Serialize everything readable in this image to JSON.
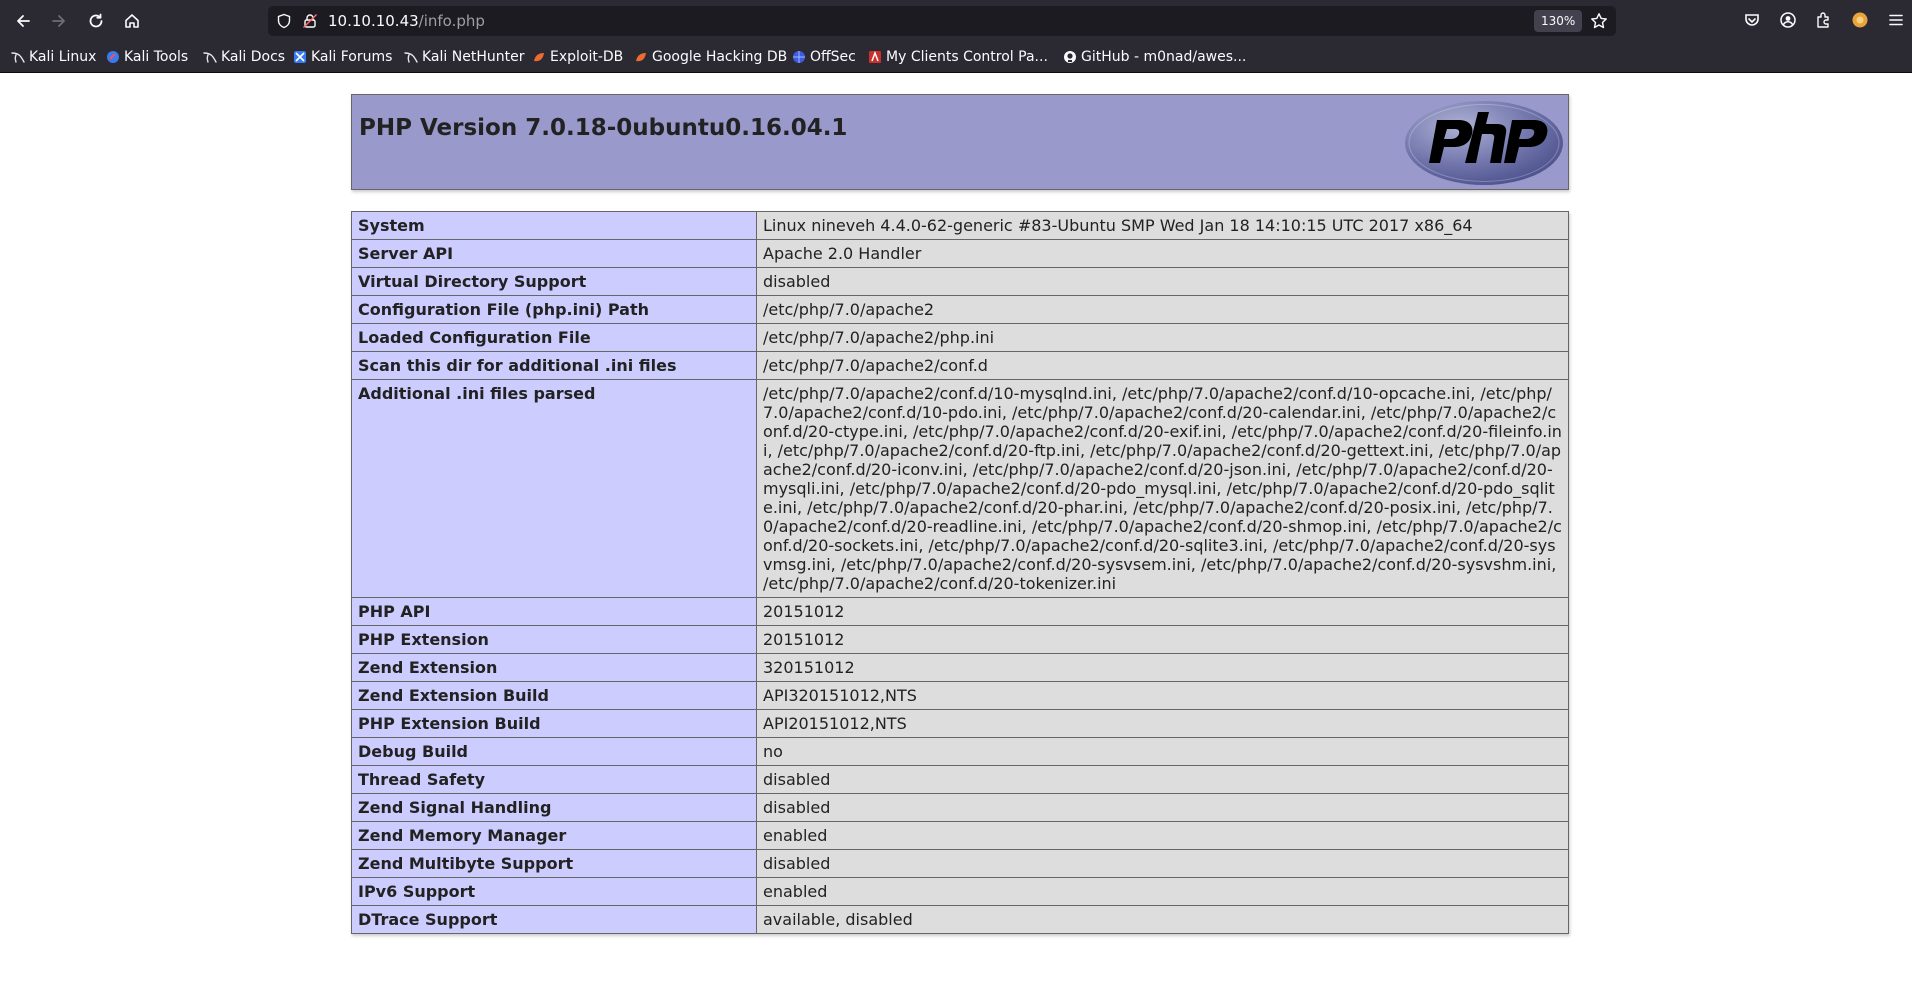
{
  "browser": {
    "url_host": "10.10.10.43",
    "url_path": "/info.php",
    "zoom": "130%",
    "bookmarks": [
      {
        "label": "Kali Linux",
        "icon": "kali-dragon-icon"
      },
      {
        "label": "Kali Tools",
        "icon": "kali-tools-icon"
      },
      {
        "label": "Kali Docs",
        "icon": "kali-dragon-icon"
      },
      {
        "label": "Kali Forums",
        "icon": "kali-forums-icon"
      },
      {
        "label": "Kali NetHunter",
        "icon": "kali-dragon-icon"
      },
      {
        "label": "Exploit-DB",
        "icon": "exploit-db-icon"
      },
      {
        "label": "Google Hacking DB",
        "icon": "exploit-db-icon"
      },
      {
        "label": "OffSec",
        "icon": "offsec-icon"
      },
      {
        "label": "My Clients Control Pa...",
        "icon": "clients-icon"
      },
      {
        "label": "GitHub - m0nad/awes...",
        "icon": "github-icon"
      }
    ]
  },
  "php": {
    "title": "PHP Version 7.0.18-0ubuntu0.16.04.1",
    "rows": [
      {
        "key": "System",
        "value": "Linux nineveh 4.4.0-62-generic #83-Ubuntu SMP Wed Jan 18 14:10:15 UTC 2017 x86_64"
      },
      {
        "key": "Server API",
        "value": "Apache 2.0 Handler"
      },
      {
        "key": "Virtual Directory Support",
        "value": "disabled"
      },
      {
        "key": "Configuration File (php.ini) Path",
        "value": "/etc/php/7.0/apache2"
      },
      {
        "key": "Loaded Configuration File",
        "value": "/etc/php/7.0/apache2/php.ini"
      },
      {
        "key": "Scan this dir for additional .ini files",
        "value": "/etc/php/7.0/apache2/conf.d"
      },
      {
        "key": "Additional .ini files parsed",
        "value": "/etc/php/7.0/apache2/conf.d/10-mysqlnd.ini, /etc/php/7.0/apache2/conf.d/10-opcache.ini, /etc/php/7.0/apache2/conf.d/10-pdo.ini, /etc/php/7.0/apache2/conf.d/20-calendar.ini, /etc/php/7.0/apache2/conf.d/20-ctype.ini, /etc/php/7.0/apache2/conf.d/20-exif.ini, /etc/php/7.0/apache2/conf.d/20-fileinfo.ini, /etc/php/7.0/apache2/conf.d/20-ftp.ini, /etc/php/7.0/apache2/conf.d/20-gettext.ini, /etc/php/7.0/apache2/conf.d/20-iconv.ini, /etc/php/7.0/apache2/conf.d/20-json.ini, /etc/php/7.0/apache2/conf.d/20-mysqli.ini, /etc/php/7.0/apache2/conf.d/20-pdo_mysql.ini, /etc/php/7.0/apache2/conf.d/20-pdo_sqlite.ini, /etc/php/7.0/apache2/conf.d/20-phar.ini, /etc/php/7.0/apache2/conf.d/20-posix.ini, /etc/php/7.0/apache2/conf.d/20-readline.ini, /etc/php/7.0/apache2/conf.d/20-shmop.ini, /etc/php/7.0/apache2/conf.d/20-sockets.ini, /etc/php/7.0/apache2/conf.d/20-sqlite3.ini, /etc/php/7.0/apache2/conf.d/20-sysvmsg.ini, /etc/php/7.0/apache2/conf.d/20-sysvsem.ini, /etc/php/7.0/apache2/conf.d/20-sysvshm.ini, /etc/php/7.0/apache2/conf.d/20-tokenizer.ini"
      },
      {
        "key": "PHP API",
        "value": "20151012"
      },
      {
        "key": "PHP Extension",
        "value": "20151012"
      },
      {
        "key": "Zend Extension",
        "value": "320151012"
      },
      {
        "key": "Zend Extension Build",
        "value": "API320151012,NTS"
      },
      {
        "key": "PHP Extension Build",
        "value": "API20151012,NTS"
      },
      {
        "key": "Debug Build",
        "value": "no"
      },
      {
        "key": "Thread Safety",
        "value": "disabled"
      },
      {
        "key": "Zend Signal Handling",
        "value": "disabled"
      },
      {
        "key": "Zend Memory Manager",
        "value": "enabled"
      },
      {
        "key": "Zend Multibyte Support",
        "value": "disabled"
      },
      {
        "key": "IPv6 Support",
        "value": "enabled"
      },
      {
        "key": "DTrace Support",
        "value": "available, disabled"
      }
    ]
  }
}
